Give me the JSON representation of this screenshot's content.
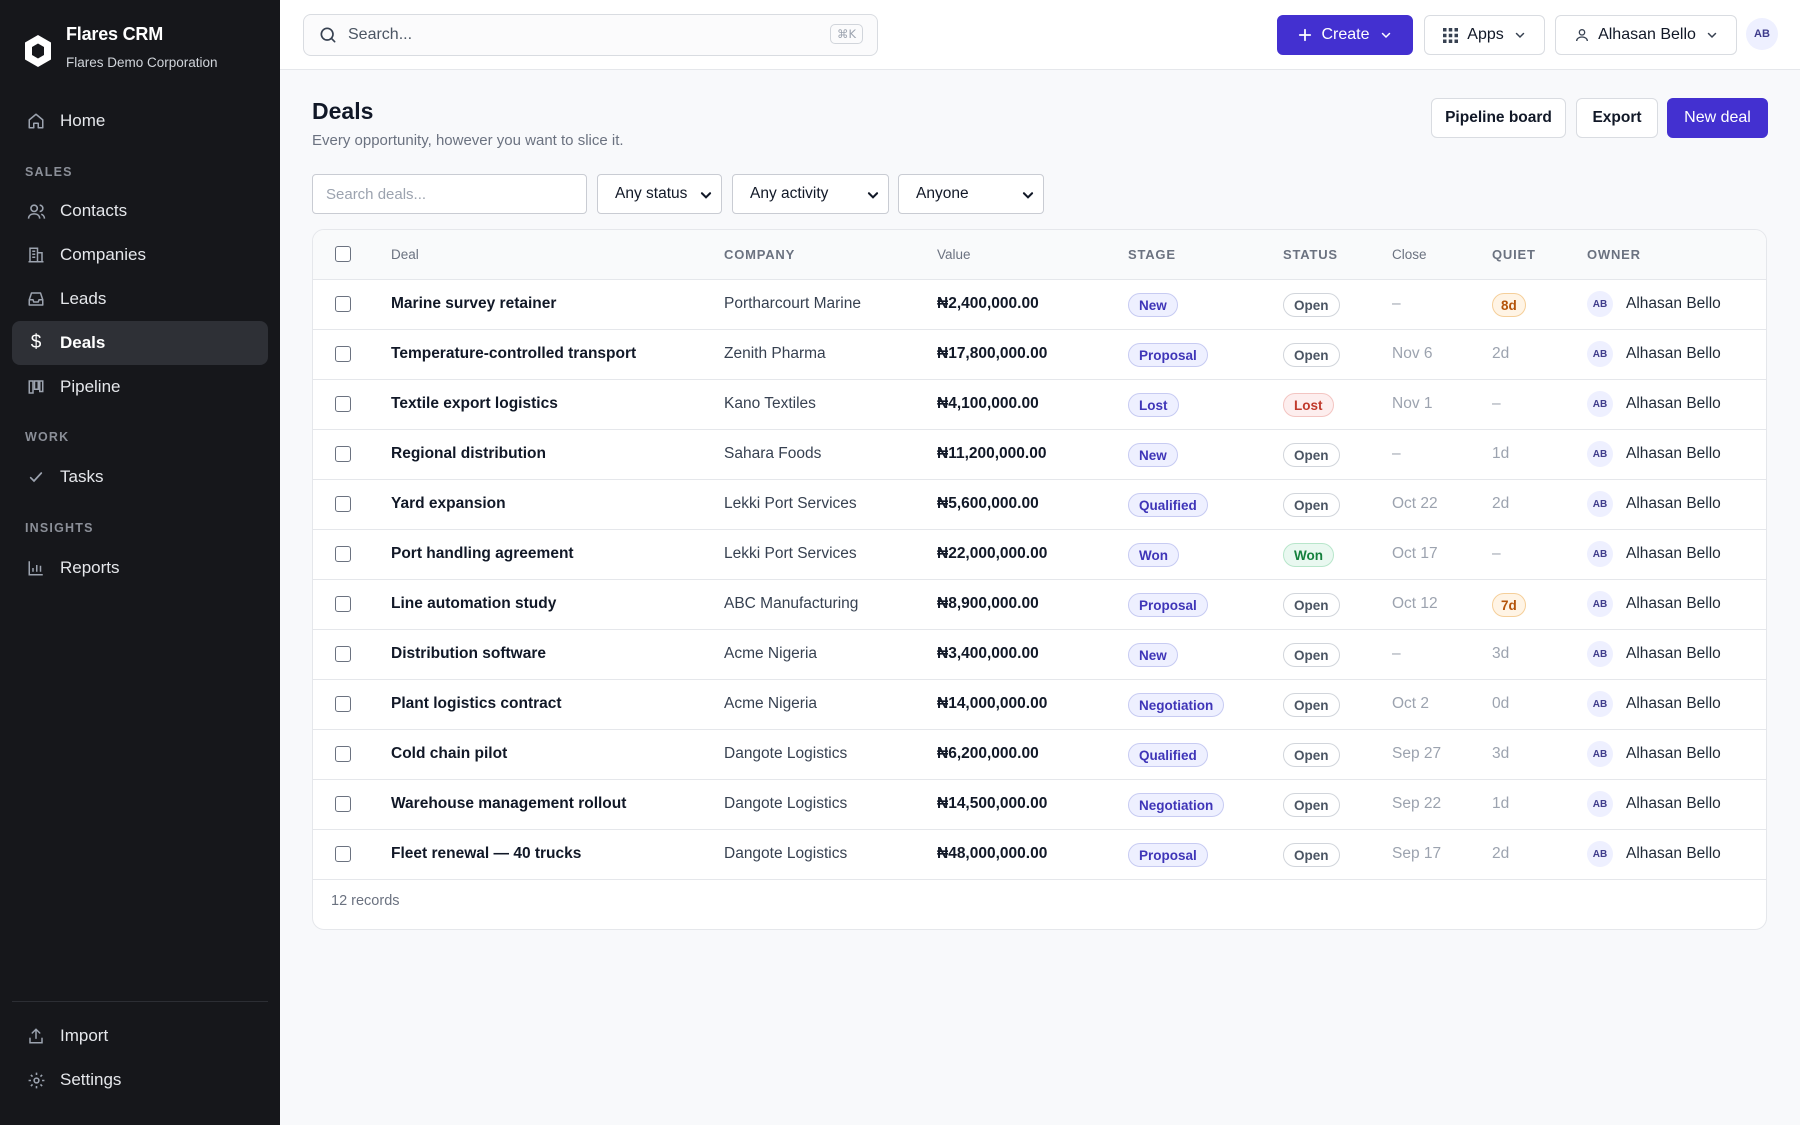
{
  "app": {
    "name": "Flares CRM",
    "org": "Flares Demo Corporation"
  },
  "sidebar": {
    "items": [
      {
        "label": "Home",
        "icon": "home-icon"
      },
      {
        "label": "Contacts",
        "icon": "users-icon"
      },
      {
        "label": "Companies",
        "icon": "building-icon"
      },
      {
        "label": "Leads",
        "icon": "inbox-icon"
      },
      {
        "label": "Deals",
        "icon": "dollar-icon",
        "active": true
      },
      {
        "label": "Pipeline",
        "icon": "kanban-icon"
      },
      {
        "label": "Tasks",
        "icon": "check-icon"
      },
      {
        "label": "Reports",
        "icon": "bar-chart-icon"
      },
      {
        "label": "Import",
        "icon": "upload-icon"
      },
      {
        "label": "Settings",
        "icon": "gear-icon"
      }
    ],
    "sections": [
      "SALES",
      "WORK",
      "INSIGHTS"
    ]
  },
  "topbar": {
    "search_placeholder": "Search...",
    "search_shortcut": "⌘K",
    "create_label": "Create",
    "apps_label": "Apps",
    "user_name": "Alhasan Bello",
    "user_initials": "AB"
  },
  "page": {
    "title": "Deals",
    "subtitle": "Every opportunity, however you want to slice it.",
    "pipeline_board_label": "Pipeline board",
    "export_label": "Export",
    "new_deal_label": "New deal"
  },
  "filters": {
    "search_placeholder": "Search deals...",
    "status_value": "Any status",
    "activity_value": "Any activity",
    "owner_value": "Anyone"
  },
  "table": {
    "headers": {
      "deal": "Deal",
      "company": "COMPANY",
      "value": "Value",
      "stage": "STAGE",
      "status": "STATUS",
      "close": "Close",
      "quiet": "QUIET",
      "owner": "OWNER"
    },
    "rows": [
      {
        "deal": "Marine survey retainer",
        "company": "Portharcourt Marine",
        "value": "₦2,400,000.00",
        "stage": "New",
        "status": "Open",
        "close": "–",
        "quiet": "8d",
        "quiet_alert": true,
        "owner_initials": "AB",
        "owner": "Alhasan Bello"
      },
      {
        "deal": "Temperature-controlled transport",
        "company": "Zenith Pharma",
        "value": "₦17,800,000.00",
        "stage": "Proposal",
        "status": "Open",
        "close": "Nov 6",
        "quiet": "2d",
        "quiet_alert": false,
        "owner_initials": "AB",
        "owner": "Alhasan Bello"
      },
      {
        "deal": "Textile export logistics",
        "company": "Kano Textiles",
        "value": "₦4,100,000.00",
        "stage": "Lost",
        "status": "Lost",
        "close": "Nov 1",
        "quiet": "–",
        "quiet_alert": false,
        "owner_initials": "AB",
        "owner": "Alhasan Bello"
      },
      {
        "deal": "Regional distribution",
        "company": "Sahara Foods",
        "value": "₦11,200,000.00",
        "stage": "New",
        "status": "Open",
        "close": "–",
        "quiet": "1d",
        "quiet_alert": false,
        "owner_initials": "AB",
        "owner": "Alhasan Bello"
      },
      {
        "deal": "Yard expansion",
        "company": "Lekki Port Services",
        "value": "₦5,600,000.00",
        "stage": "Qualified",
        "status": "Open",
        "close": "Oct 22",
        "quiet": "2d",
        "quiet_alert": false,
        "owner_initials": "AB",
        "owner": "Alhasan Bello"
      },
      {
        "deal": "Port handling agreement",
        "company": "Lekki Port Services",
        "value": "₦22,000,000.00",
        "stage": "Won",
        "status": "Won",
        "close": "Oct 17",
        "quiet": "–",
        "quiet_alert": false,
        "owner_initials": "AB",
        "owner": "Alhasan Bello"
      },
      {
        "deal": "Line automation study",
        "company": "ABC Manufacturing",
        "value": "₦8,900,000.00",
        "stage": "Proposal",
        "status": "Open",
        "close": "Oct 12",
        "quiet": "7d",
        "quiet_alert": true,
        "owner_initials": "AB",
        "owner": "Alhasan Bello"
      },
      {
        "deal": "Distribution software",
        "company": "Acme Nigeria",
        "value": "₦3,400,000.00",
        "stage": "New",
        "status": "Open",
        "close": "–",
        "quiet": "3d",
        "quiet_alert": false,
        "owner_initials": "AB",
        "owner": "Alhasan Bello"
      },
      {
        "deal": "Plant logistics contract",
        "company": "Acme Nigeria",
        "value": "₦14,000,000.00",
        "stage": "Negotiation",
        "status": "Open",
        "close": "Oct 2",
        "quiet": "0d",
        "quiet_alert": false,
        "owner_initials": "AB",
        "owner": "Alhasan Bello"
      },
      {
        "deal": "Cold chain pilot",
        "company": "Dangote Logistics",
        "value": "₦6,200,000.00",
        "stage": "Qualified",
        "status": "Open",
        "close": "Sep 27",
        "quiet": "3d",
        "quiet_alert": false,
        "owner_initials": "AB",
        "owner": "Alhasan Bello"
      },
      {
        "deal": "Warehouse management rollout",
        "company": "Dangote Logistics",
        "value": "₦14,500,000.00",
        "stage": "Negotiation",
        "status": "Open",
        "close": "Sep 22",
        "quiet": "1d",
        "quiet_alert": false,
        "owner_initials": "AB",
        "owner": "Alhasan Bello"
      },
      {
        "deal": "Fleet renewal — 40 trucks",
        "company": "Dangote Logistics",
        "value": "₦48,000,000.00",
        "stage": "Proposal",
        "status": "Open",
        "close": "Sep 17",
        "quiet": "2d",
        "quiet_alert": false,
        "owner_initials": "AB",
        "owner": "Alhasan Bello"
      }
    ],
    "footer": "12 records"
  },
  "colors": {
    "primary": "#4330d0",
    "sidebar_bg": "#16171b",
    "sidebar_active": "#2e3036"
  }
}
